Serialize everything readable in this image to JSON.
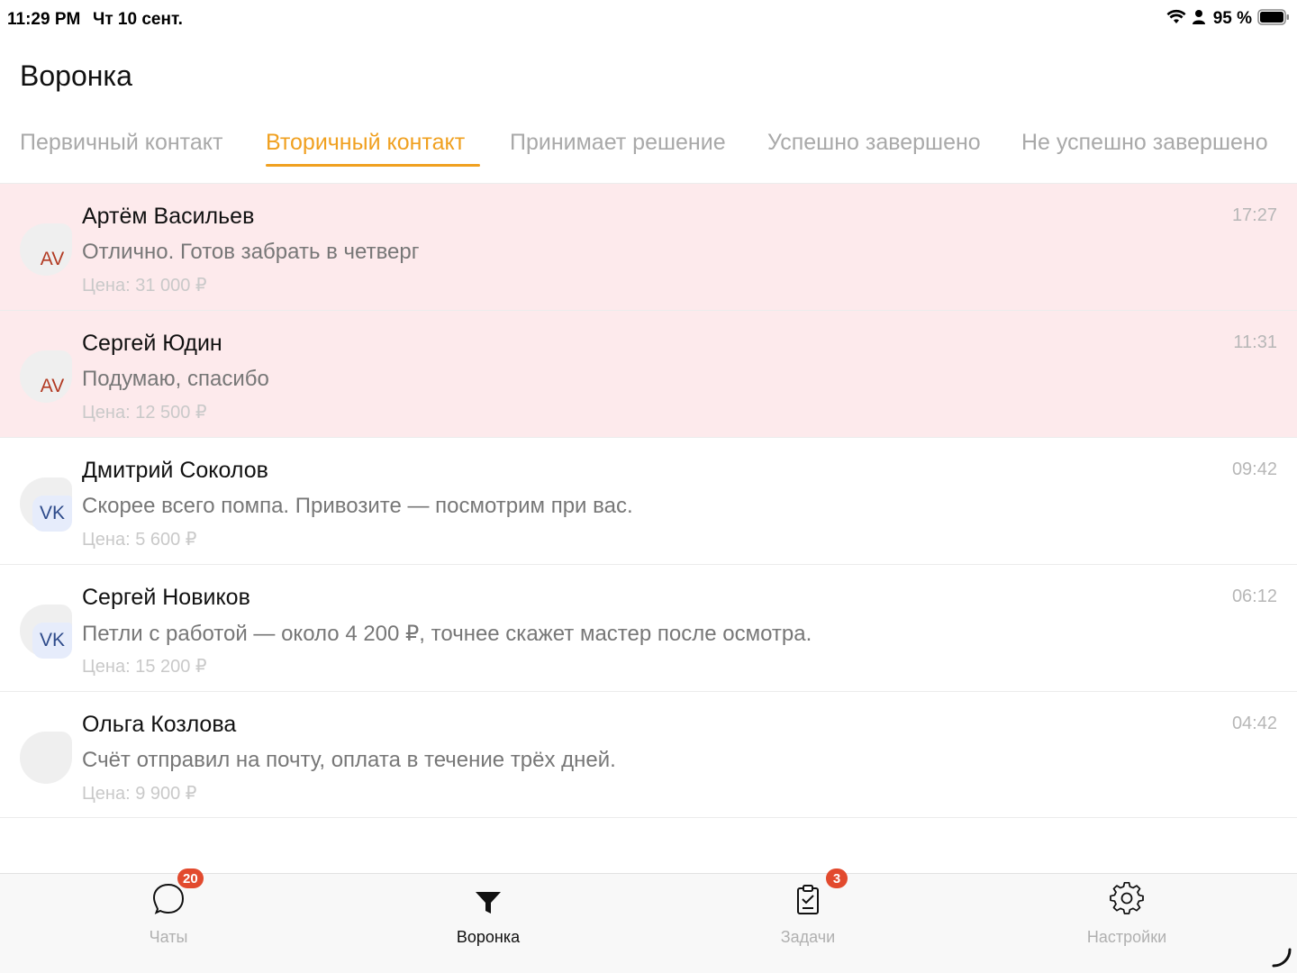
{
  "status_bar": {
    "time": "11:29 PM",
    "date": "Чт 10 сент.",
    "battery": "95 %",
    "icons": [
      "wifi-icon",
      "person-icon",
      "battery-icon"
    ]
  },
  "header": {
    "title": "Воронка"
  },
  "tabs": [
    {
      "label": "Первичный контакт",
      "active": false
    },
    {
      "label": "Вторичный контакт",
      "active": true
    },
    {
      "label": "Принимает решение",
      "active": false
    },
    {
      "label": "Успешно завершено",
      "active": false
    },
    {
      "label": "Не успешно завершено",
      "active": false
    }
  ],
  "leads": [
    {
      "name": "Артём Васильев",
      "message": "Отлично. Готов забрать в четверг",
      "price": "Цена: 31 000 ₽",
      "time": "17:27",
      "badge": "AV",
      "highlight": true
    },
    {
      "name": "Сергей Юдин",
      "message": "Подумаю, спасибо",
      "price": "Цена: 12 500 ₽",
      "time": "11:31",
      "badge": "AV",
      "highlight": true
    },
    {
      "name": "Дмитрий Соколов",
      "message": "Скорее всего помпа. Привозите — посмотрим при вас.",
      "price": "Цена: 5 600 ₽",
      "time": "09:42",
      "badge": "VK",
      "highlight": false
    },
    {
      "name": "Сергей Новиков",
      "message": "Петли с работой — около 4 200 ₽, точнее скажет мастер после осмотра.",
      "price": "Цена: 15 200 ₽",
      "time": "06:12",
      "badge": "VK",
      "highlight": false
    },
    {
      "name": "Ольга Козлова",
      "message": "Счёт отправил на почту, оплата в течение трёх дней.",
      "price": "Цена: 9 900 ₽",
      "time": "04:42",
      "badge": "",
      "highlight": false
    }
  ],
  "tabbar": {
    "chats": {
      "label": "Чаты",
      "badge": "20",
      "icon": "chat-bubble-icon"
    },
    "funnel": {
      "label": "Воронка",
      "icon": "funnel-icon",
      "active": true
    },
    "tasks": {
      "label": "Задачи",
      "badge": "3",
      "icon": "clipboard-check-icon"
    },
    "settings": {
      "label": "Настройки",
      "icon": "gear-icon"
    }
  },
  "colors": {
    "accent": "#f0a020",
    "highlight_row": "#fdeaec",
    "badge_red": "#e24a2e",
    "av_text": "#b23a22",
    "vk_text": "#2d4a8a"
  }
}
